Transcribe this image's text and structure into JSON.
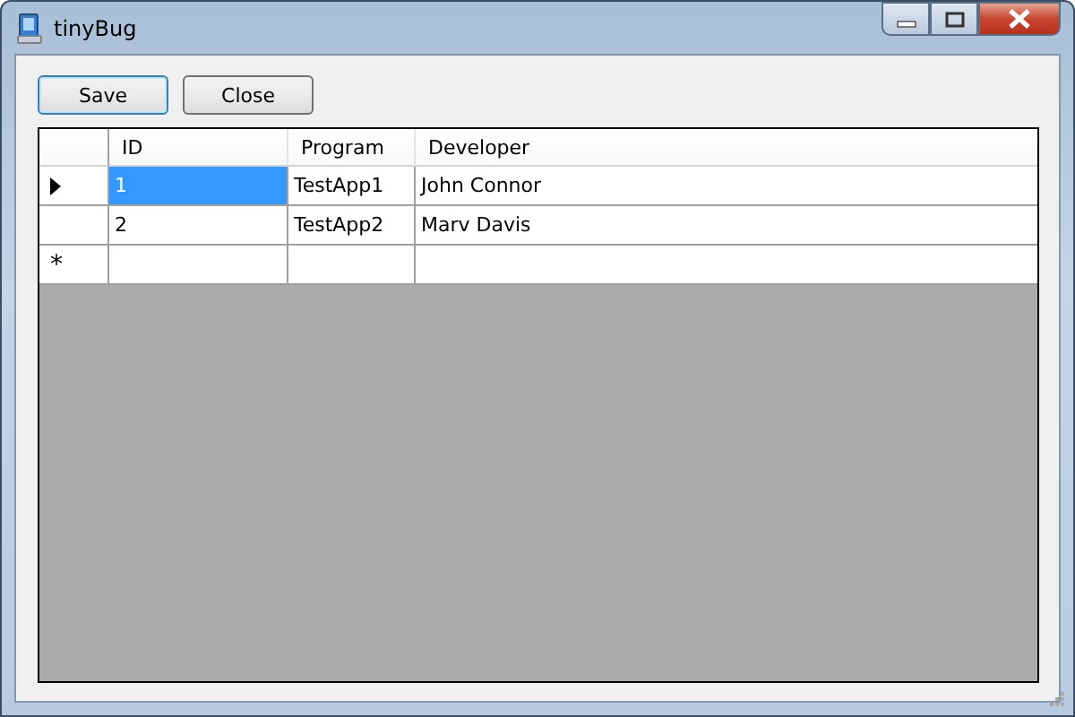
{
  "window": {
    "title": "tinyBug"
  },
  "buttons": [
    {
      "label": "Save",
      "focused": true
    },
    {
      "label": "Close",
      "focused": false
    }
  ],
  "table": {
    "columns": [
      "ID",
      "Program",
      "Developer"
    ],
    "rows": [
      {
        "cells": [
          "1",
          "TestApp1",
          "John Connor"
        ],
        "selected": true
      },
      {
        "cells": [
          "2",
          "TestApp2",
          "Marv Davis"
        ],
        "selected": false
      }
    ],
    "new_row_marker": "*"
  }
}
